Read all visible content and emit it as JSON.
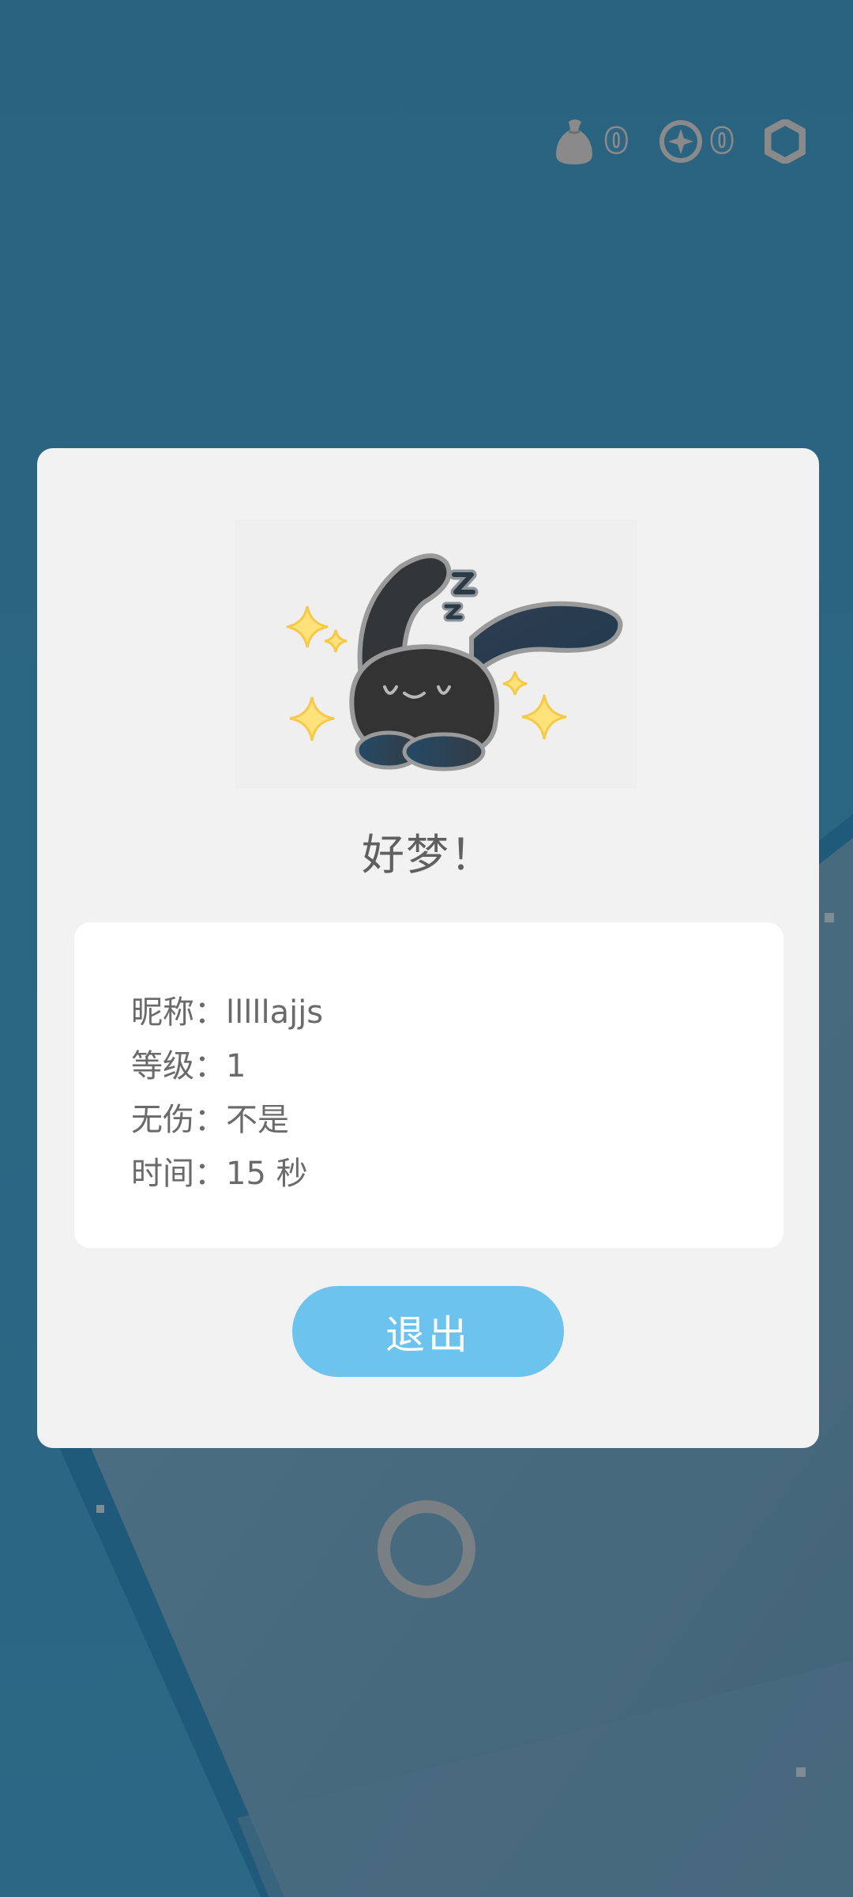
{
  "hud": {
    "sacks": {
      "icon": "sack-icon",
      "count": "0"
    },
    "coins": {
      "icon": "compass-coin-icon",
      "count": "0"
    },
    "settings": {
      "icon": "hexagon-settings-icon"
    }
  },
  "modal": {
    "title": "好梦！",
    "mascot_icon": "sleeping-rabbit-icon",
    "info": {
      "nickname": "昵称：lllllajjs",
      "level": "等级：1",
      "no_damage": "无伤：不是",
      "time": "时间：15 秒"
    },
    "exit_label": "退出"
  },
  "colors": {
    "background": "#2a6480",
    "panel": "#f2f2f2",
    "card": "#ffffff",
    "button": "#6cc4ee",
    "text": "#606060"
  }
}
